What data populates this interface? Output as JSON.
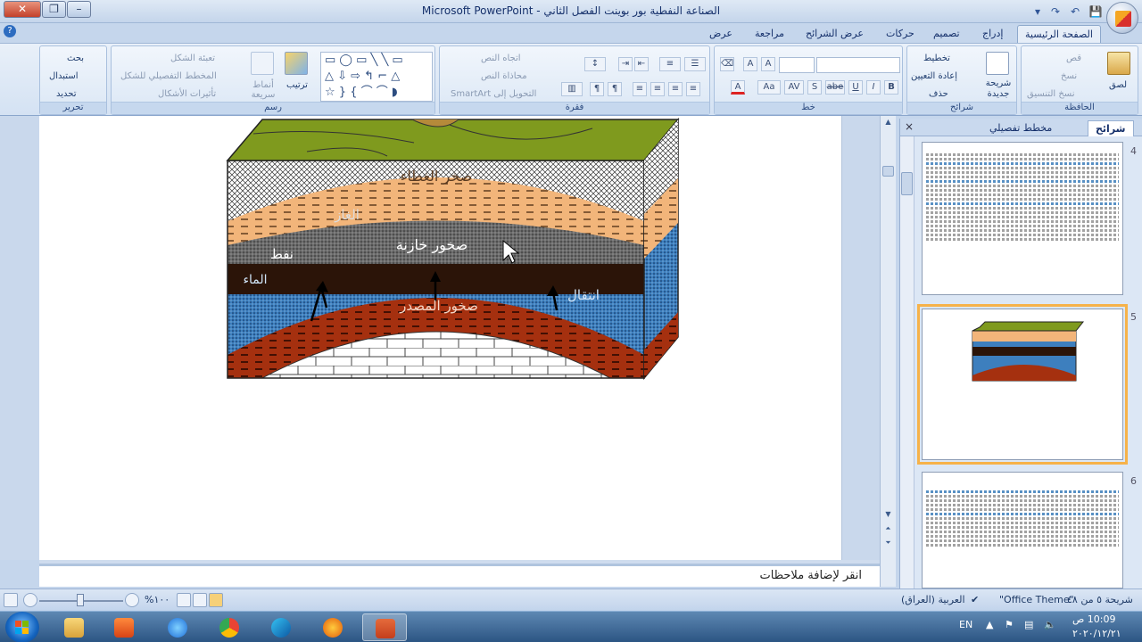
{
  "window": {
    "title": "الصناعة النفطية بور بوينت  الفصل الثاني - Microsoft PowerPoint"
  },
  "tabs": [
    "الصفحة الرئيسية",
    "إدراج",
    "تصميم",
    "حركات",
    "عرض الشرائح",
    "مراجعة",
    "عرض"
  ],
  "ribbon": {
    "clipboard": {
      "label": "الحافظة",
      "paste": "لصق",
      "cut": "قص",
      "copy": "نسخ",
      "format_painter": "نسخ التنسيق"
    },
    "slides": {
      "label": "شرائح",
      "new_slide": "شريحة جديدة",
      "layout": "تخطيط",
      "reset": "إعادة التعيين",
      "delete": "حذف"
    },
    "font": {
      "label": "خط",
      "bold": "B",
      "italic": "I",
      "underline": "U",
      "strike": "abe",
      "shadow": "S",
      "spacing": "AV",
      "case": "Aa",
      "color": "A",
      "grow": "A",
      "shrink": "A"
    },
    "paragraph": {
      "label": "فقرة",
      "text_direction": "اتجاه النص",
      "align_text": "محاذاة النص",
      "smartart": "التحويل إلى SmartArt"
    },
    "drawing": {
      "label": "رسم",
      "arrange": "ترتيب",
      "quick_styles": "أنماط سريعة",
      "shape_fill": "تعبئة الشكل",
      "shape_outline": "المخطط التفصيلي للشكل",
      "shape_effects": "تأثيرات الأشكال"
    },
    "editing": {
      "label": "تحرير",
      "find": "بحث",
      "replace": "استبدال",
      "select": "تحديد"
    }
  },
  "slide": {
    "labels": {
      "cap_rock": "صخر الغطاء",
      "gas": "الغاز",
      "reservoir": "صخور خازنة",
      "oil": "نفط",
      "water": "الماء",
      "migration": "انتقال",
      "source": "صخور المصدر"
    }
  },
  "notes": {
    "text": "انقر لإضافة ملاحظات"
  },
  "panel": {
    "tab_slides": "شرائح",
    "tab_outline": "مخطط تفصيلي",
    "close": "×",
    "slide_numbers": [
      "4",
      "5",
      "6"
    ]
  },
  "statusbar": {
    "slide_info": "شريحة ٥ من ٤٨",
    "theme": "\"Office Theme\"",
    "language": "العربية (العراق)",
    "zoom": "%١٠٠"
  },
  "taskbar": {
    "lang": "EN",
    "time": "10:09 ص",
    "date": "٢٠٢٠/١٢/٢١"
  },
  "colors": {
    "ribbon": "#dbe7f5",
    "accent": "#f6b24a",
    "taskbar": "#2c5583"
  }
}
